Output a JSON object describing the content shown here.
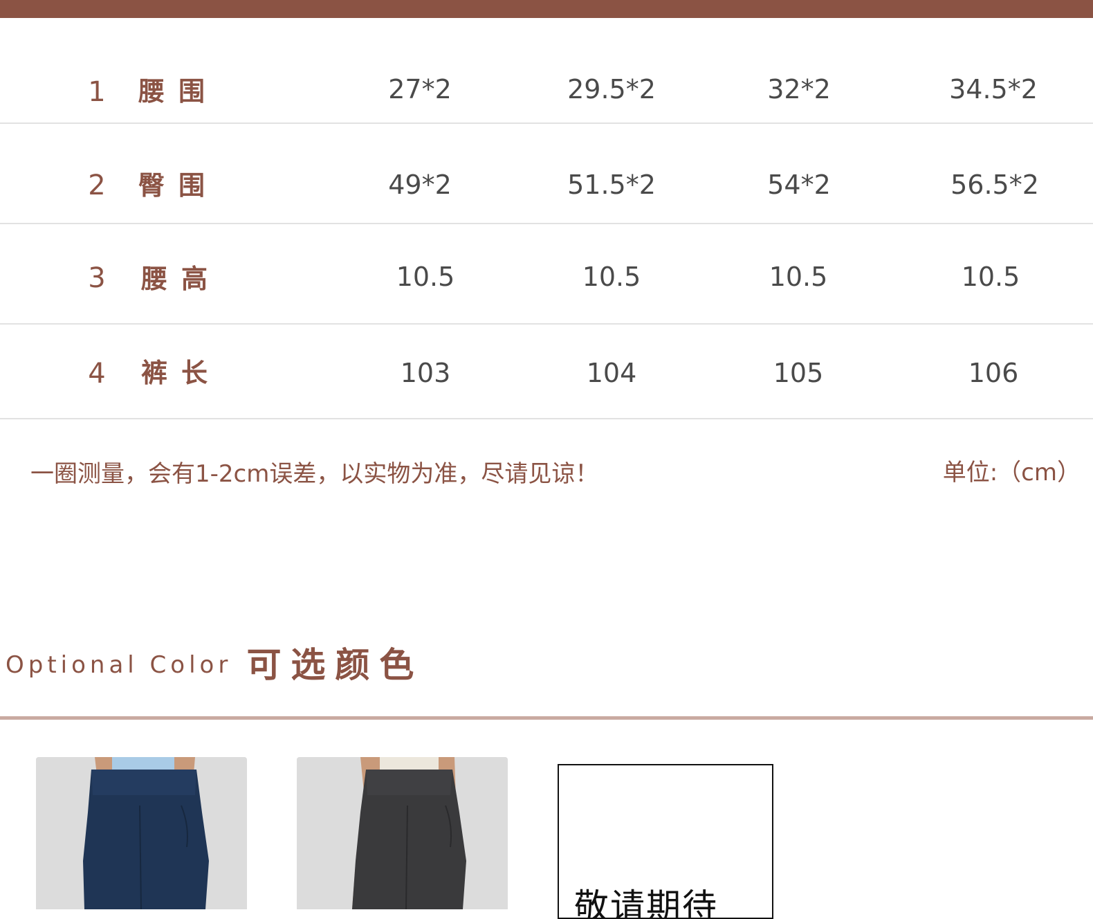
{
  "size_rows": [
    {
      "num": "1",
      "label": "腰围",
      "values": [
        "27*2",
        "29.5*2",
        "32*2",
        "34.5*2"
      ]
    },
    {
      "num": "2",
      "label": "臀围",
      "values": [
        "49*2",
        "51.5*2",
        "54*2",
        "56.5*2"
      ]
    },
    {
      "num": "3",
      "label": "腰高",
      "values": [
        "10.5",
        "10.5",
        "10.5",
        "10.5"
      ]
    },
    {
      "num": "4",
      "label": "裤长",
      "values": [
        "103",
        "104",
        "105",
        "106"
      ]
    }
  ],
  "note": "一圈测量，会有1-2cm误差，以实物为准，尽请见谅！",
  "unit": "单位:（cm）",
  "color_section": {
    "title_en": "Optional Color",
    "title_cn": "可选颜色"
  },
  "swatches": [
    {
      "name": "navy",
      "pants_color": "#1f3555",
      "top_color": "#a9cbe6"
    },
    {
      "name": "charcoal",
      "pants_color": "#3a3a3c",
      "top_color": "#ece7dc"
    }
  ],
  "placeholder_text": "敬请期待",
  "colors": {
    "accent": "#8b5344",
    "value_text": "#4a4a4a"
  }
}
